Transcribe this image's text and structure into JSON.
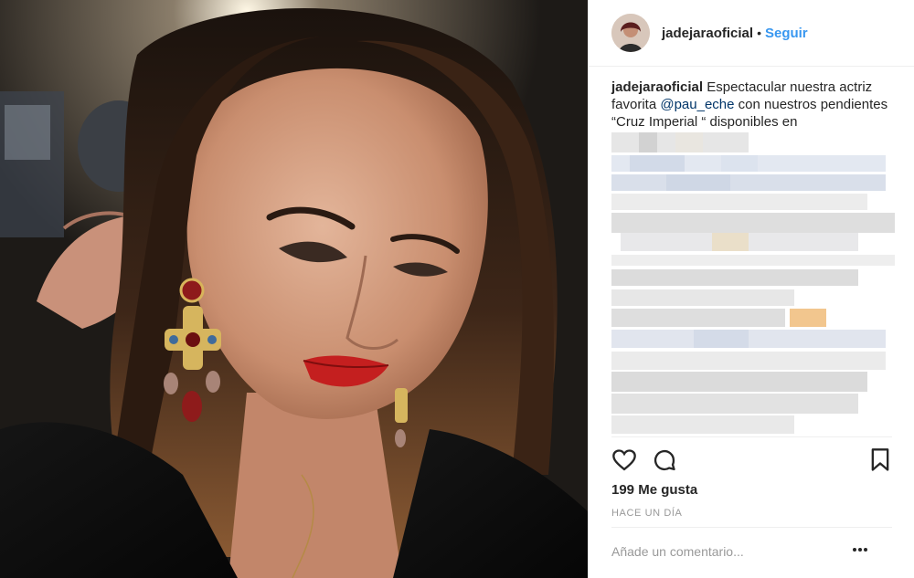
{
  "post": {
    "username": "jadejaraoficial",
    "follow_label": "Seguir",
    "separator": "•"
  },
  "caption": {
    "username": "jadejaraoficial",
    "text_before": " Espectacular nuestra actriz favorita ",
    "mention": "@pau_eche",
    "text_after": " con nuestros pendientes “Cruz Imperial “ disponibles en"
  },
  "likes_text": "199 Me gusta",
  "time_ago": "HACE UN DÍA",
  "comment": {
    "placeholder": "Añade un comentario..."
  },
  "colors": {
    "link_blue": "#3897f0",
    "text": "#262626",
    "muted": "#999999",
    "divider": "#efefef",
    "lipstick": "#c41f1f"
  },
  "icons": {
    "like": "heart-icon",
    "comment": "comment-bubble-icon",
    "save": "bookmark-icon",
    "more": "more-dots-icon"
  }
}
